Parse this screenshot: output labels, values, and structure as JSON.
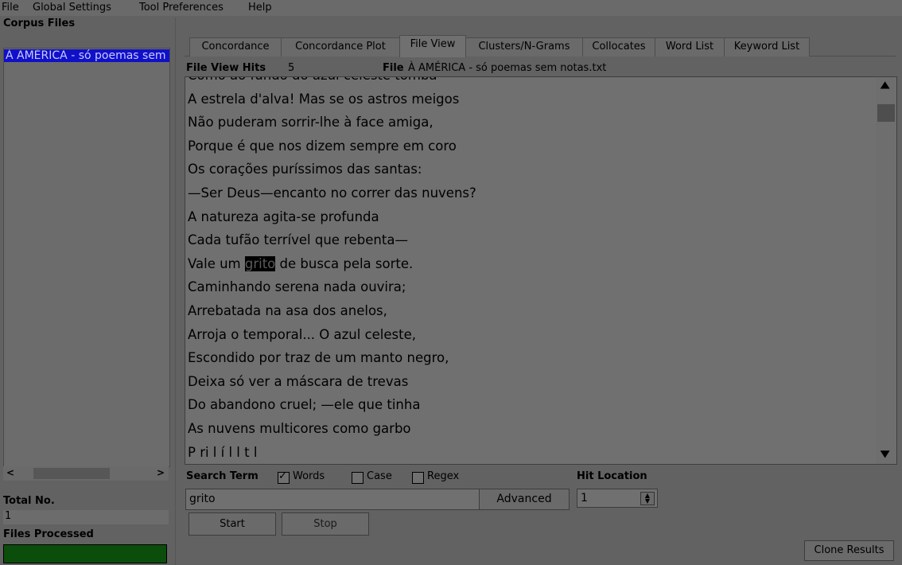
{
  "menu": {
    "items": [
      {
        "label": "File"
      },
      {
        "label": "Global Settings"
      },
      {
        "label": "Tool Preferences"
      },
      {
        "label": "Help"
      }
    ]
  },
  "corpus": {
    "header": "Corpus Files",
    "files": [
      "À AMÉRICA - só poemas sem notas.txt"
    ]
  },
  "tabs": [
    {
      "label": "Concordance"
    },
    {
      "label": "Concordance Plot"
    },
    {
      "label": "File View"
    },
    {
      "label": "Clusters/N-Grams"
    },
    {
      "label": "Collocates"
    },
    {
      "label": "Word List"
    },
    {
      "label": "Keyword List"
    }
  ],
  "active_tab": "File View",
  "fileview": {
    "hits_label": "File View Hits",
    "hits_value": "5",
    "file_label": "File",
    "file_value": "À AMÉRICA - só poemas sem notas.txt",
    "lines": [
      "Como ao fundo do azul celeste tomba",
      "A estrela d'alva! Mas se os astros meigos",
      "Não puderam sorrir-lhe à face amiga,",
      "Porque é que nos dizem sempre em coro",
      "Os corações puríssimos das santas:",
      "—Ser Deus—encanto no correr das nuvens?",
      "A natureza agita-se profunda",
      "Cada tufão terrível que rebenta—",
      {
        "before": "Vale um ",
        "hit": "grito",
        "after": " de busca pela sorte."
      },
      "Caminhando serena nada ouvira;",
      "Arrebatada na asa dos anelos,",
      "Arroja o temporal... O azul celeste,",
      "Escondido por traz de um manto negro,",
      "Deixa só ver a máscara de trevas",
      "Do abandono cruel; —ele que tinha",
      "As nuvens multicores como garbo",
      "P  ri  l       í  l  l  t  l"
    ]
  },
  "search": {
    "label": "Search Term",
    "words_label": "Words",
    "words_checked": true,
    "case_label": "Case",
    "case_checked": false,
    "regex_label": "Regex",
    "regex_checked": false,
    "term": "grito",
    "advanced_label": "Advanced",
    "hit_location_label": "Hit Location",
    "hit_location_value": "1",
    "start_label": "Start",
    "stop_label": "Stop",
    "clone_label": "Clone Results"
  },
  "status": {
    "total_label": "Total No.",
    "total_value": "1",
    "processed_label": "Files Processed",
    "progress_fraction": 1.0,
    "progress_color": "#0b4d0b"
  },
  "icons": {
    "scroll_up": "▲",
    "scroll_down": "▼",
    "scroll_left": "<",
    "scroll_right": ">",
    "checkmark": "✓"
  }
}
